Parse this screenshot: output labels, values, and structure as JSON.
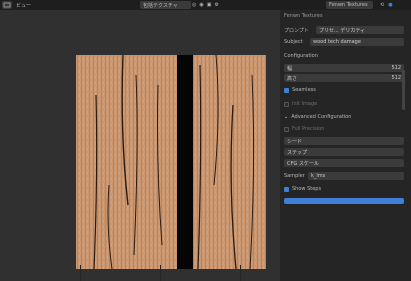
{
  "topbar": {
    "view_label": "ビュー",
    "center_field": "包括テクスチャ",
    "addon_label": "Fenwn Textures",
    "icons": [
      "editor-type-icon",
      "view-menu-icon",
      "overlay-icon",
      "shading-icon",
      "render-icon",
      "search-icon"
    ]
  },
  "panel": {
    "tab_label": "Fenwn Textures",
    "prompt_label": "プロンプト",
    "prompt_dropdown": "プリセ... デリカティ",
    "subject_label": "Subject",
    "subject_value": "wood tech damage",
    "configuration_label": "Configuration",
    "width_label": "幅",
    "width_value": "512",
    "height_label": "高さ",
    "height_value": "512",
    "seamless_label": "Seamless",
    "seamless_checked": true,
    "init_image_label": "Init Image",
    "init_image_checked": false,
    "advanced_label": "Advanced Configuration",
    "full_precision_label": "Full Precision",
    "seed_label": "シード",
    "steps_label": "ステップ",
    "cfg_label": "CFG スケール",
    "sampler_label": "Sampler",
    "sampler_value": "k_lms",
    "show_steps_label": "Show Steps",
    "show_steps_checked": true
  },
  "colors": {
    "accent": "#3f7fd6",
    "wood": "#c99670",
    "panel_bg": "#252525",
    "viewport_bg": "#303030"
  }
}
